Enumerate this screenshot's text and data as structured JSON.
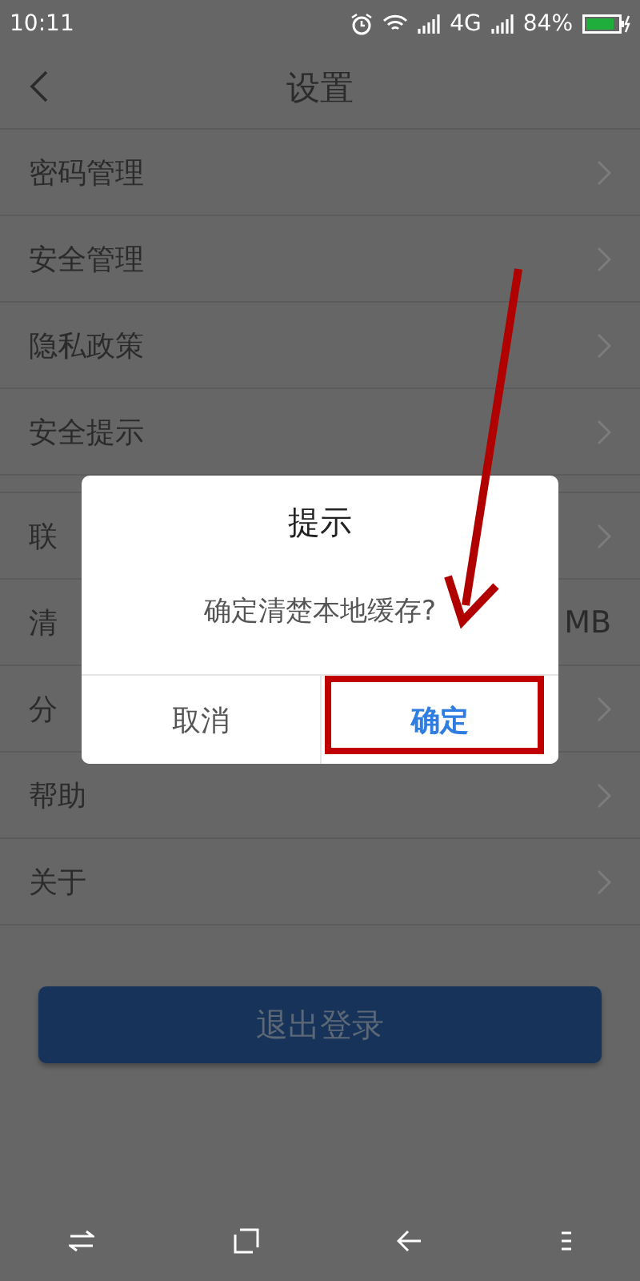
{
  "status_bar": {
    "time": "10:11",
    "network": "4G",
    "battery_text": "84%"
  },
  "header": {
    "title": "设置"
  },
  "sections": [
    [
      {
        "label": "密码管理"
      },
      {
        "label": "安全管理"
      },
      {
        "label": "隐私政策"
      },
      {
        "label": "安全提示"
      }
    ],
    [
      {
        "label": "联"
      },
      {
        "label": "清",
        "value": "MB"
      },
      {
        "label": "分"
      },
      {
        "label": "帮助"
      },
      {
        "label": "关于"
      }
    ]
  ],
  "logout_button": {
    "label": "退出登录"
  },
  "dialog": {
    "title": "提示",
    "message": "确定清楚本地缓存?",
    "buttons": [
      {
        "label": "取消",
        "selected": false
      },
      {
        "label": "确定",
        "selected": true
      }
    ]
  }
}
